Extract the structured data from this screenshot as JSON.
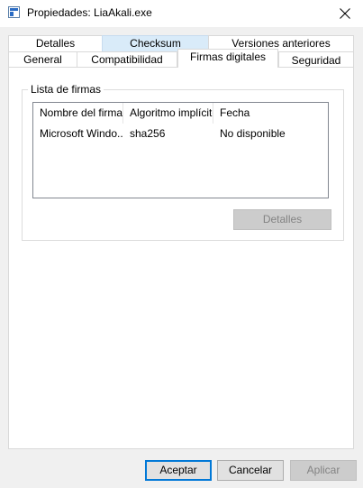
{
  "window": {
    "title": "Propiedades: LiaAkali.exe"
  },
  "tabs": {
    "row_back": [
      {
        "label": "Detalles"
      },
      {
        "label": "Checksum"
      },
      {
        "label": "Versiones anteriores"
      }
    ],
    "row_front": [
      {
        "label": "General"
      },
      {
        "label": "Compatibilidad"
      },
      {
        "label": "Firmas digitales"
      },
      {
        "label": "Seguridad"
      }
    ],
    "selected": "Firmas digitales",
    "highlighted": "Checksum",
    "highlight_color": "#d9ebf9"
  },
  "signatures": {
    "group_label": "Lista de firmas",
    "columns": [
      "Nombre del firma...",
      "Algoritmo implícito",
      "Fecha"
    ],
    "rows": [
      {
        "name": "Microsoft Windo...",
        "algorithm": "sha256",
        "date": "No disponible"
      }
    ],
    "details_button": "Detalles"
  },
  "footer": {
    "accept": "Aceptar",
    "cancel": "Cancelar",
    "apply": "Aplicar"
  },
  "colors": {
    "accent": "#0078d7",
    "disabled_button": "#cccccc"
  }
}
